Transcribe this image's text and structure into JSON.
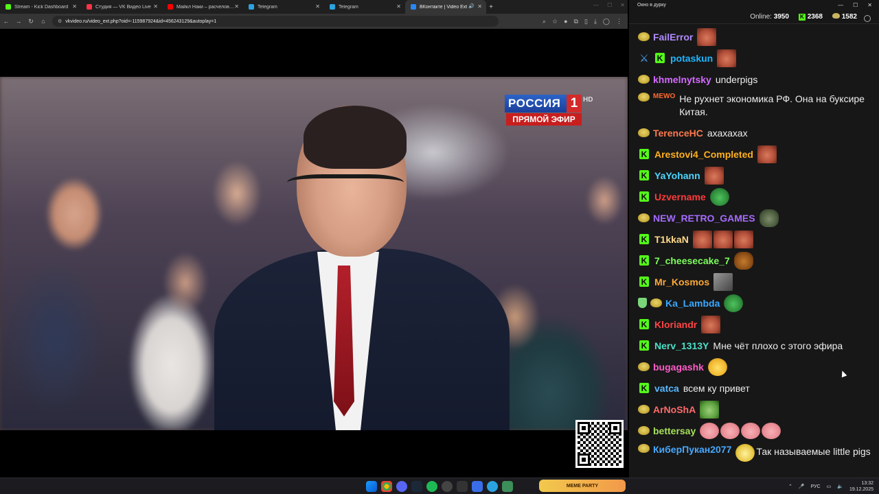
{
  "browser": {
    "tabs": [
      {
        "label": "Stream - Kick Dashboard",
        "color": "#53fc18"
      },
      {
        "label": "Студия — VK Видео Live",
        "color": "#ff3347"
      },
      {
        "label": "Майкл Наки – расчеловечени...",
        "color": "#ff0000"
      },
      {
        "label": "Telegram",
        "color": "#2aa3e0"
      },
      {
        "label": "Telegram",
        "color": "#2aa3e0"
      },
      {
        "label": "ВКонтакте | Video Ext",
        "color": "#2787f5",
        "active": true
      }
    ],
    "new_tab": "+",
    "url": "vkvideo.ru/video_ext.php?oid=-115987924&id=456243129&autoplay=1"
  },
  "video": {
    "channel": "РОССИЯ",
    "channel_num": "1",
    "hd": "HD",
    "live": "ПРЯМОЙ ЭФИР"
  },
  "chat": {
    "window_title": "Окно в дурку",
    "online_label": "Online:",
    "online_count": "3950",
    "kick_count": "2368",
    "other_count": "1582",
    "messages": [
      {
        "badges": [
          "pog"
        ],
        "user": "FailError",
        "color": "#b08cff",
        "emotes": [
          "face"
        ],
        "text": ""
      },
      {
        "badges": [
          "sword",
          "kick"
        ],
        "user": "potaskun",
        "color": "#1fb6ff",
        "emotes": [
          "face"
        ],
        "text": ""
      },
      {
        "badges": [
          "pog"
        ],
        "user": "khmelnytsky",
        "color": "#d36bff",
        "emotes": [],
        "text": "underpigs"
      },
      {
        "badges": [
          "pog"
        ],
        "user": "MEWO",
        "color": "#ff6b2e",
        "emotes": [],
        "text": "Не рухнет экономика РФ. Она на буксире Китая.",
        "small": true
      },
      {
        "badges": [
          "pog"
        ],
        "user": "TerenceHC",
        "color": "#ff7a4d",
        "emotes": [],
        "text": "ахахахах"
      },
      {
        "badges": [
          "kick"
        ],
        "user": "Arestovi4_Completed",
        "color": "#ffb020",
        "emotes": [
          "face"
        ],
        "text": ""
      },
      {
        "badges": [
          "kick"
        ],
        "user": "YaYohann",
        "color": "#4dd6ff",
        "emotes": [
          "face"
        ],
        "text": ""
      },
      {
        "badges": [
          "kick"
        ],
        "user": "Uzvername",
        "color": "#ff3b3b",
        "emotes": [
          "frog"
        ],
        "text": ""
      },
      {
        "badges": [
          "pog"
        ],
        "user": "NEW_RETRO_GAMES",
        "color": "#a66bff",
        "emotes": [
          "gator"
        ],
        "text": ""
      },
      {
        "badges": [
          "kick"
        ],
        "user": "T1kkaN",
        "color": "#ffd98a",
        "emotes": [
          "face",
          "face",
          "face"
        ],
        "text": ""
      },
      {
        "badges": [
          "kick"
        ],
        "user": "7_cheesecake_7",
        "color": "#7dff5c",
        "emotes": [
          "dog"
        ],
        "text": ""
      },
      {
        "badges": [
          "kick"
        ],
        "user": "Mr_Kosmos",
        "color": "#ffa938",
        "emotes": [
          "ak"
        ],
        "text": ""
      },
      {
        "badges": [
          "shield",
          "pog"
        ],
        "user": "Ka_Lambda",
        "color": "#3aa8ff",
        "emotes": [
          "frog"
        ],
        "text": ""
      },
      {
        "badges": [
          "kick"
        ],
        "user": "Kloriandr",
        "color": "#ff4545",
        "emotes": [
          "face"
        ],
        "text": ""
      },
      {
        "badges": [
          "kick"
        ],
        "user": "Nerv_1313Y",
        "color": "#4ce0c8",
        "emotes": [],
        "text": "Мне чёт плохо с этого эфира"
      },
      {
        "badges": [
          "pog"
        ],
        "user": "bugagashk",
        "color": "#ff5cc8",
        "emotes": [
          "lol"
        ],
        "text": ""
      },
      {
        "badges": [
          "kick"
        ],
        "user": "vatca",
        "color": "#58b8ff",
        "emotes": [],
        "text": "всем ку привет"
      },
      {
        "badges": [
          "pog"
        ],
        "user": "ArNoShA",
        "color": "#ff6b6b",
        "emotes": [
          "money"
        ],
        "text": ""
      },
      {
        "badges": [
          "pog"
        ],
        "user": "bettersay",
        "color": "#a6e05a",
        "emotes": [
          "pig",
          "pig",
          "pig",
          "pig"
        ],
        "text": ""
      },
      {
        "badges": [
          "pog"
        ],
        "user": "КиберПукан2077",
        "color": "#47a8ff",
        "emotes": [
          "troll"
        ],
        "text": "Так называемые little pigs",
        "wrap": true
      }
    ]
  },
  "taskbar": {
    "meme": "MEME PARTY",
    "lang": "РУС",
    "time": "13:32",
    "date": "19.12.2025"
  }
}
